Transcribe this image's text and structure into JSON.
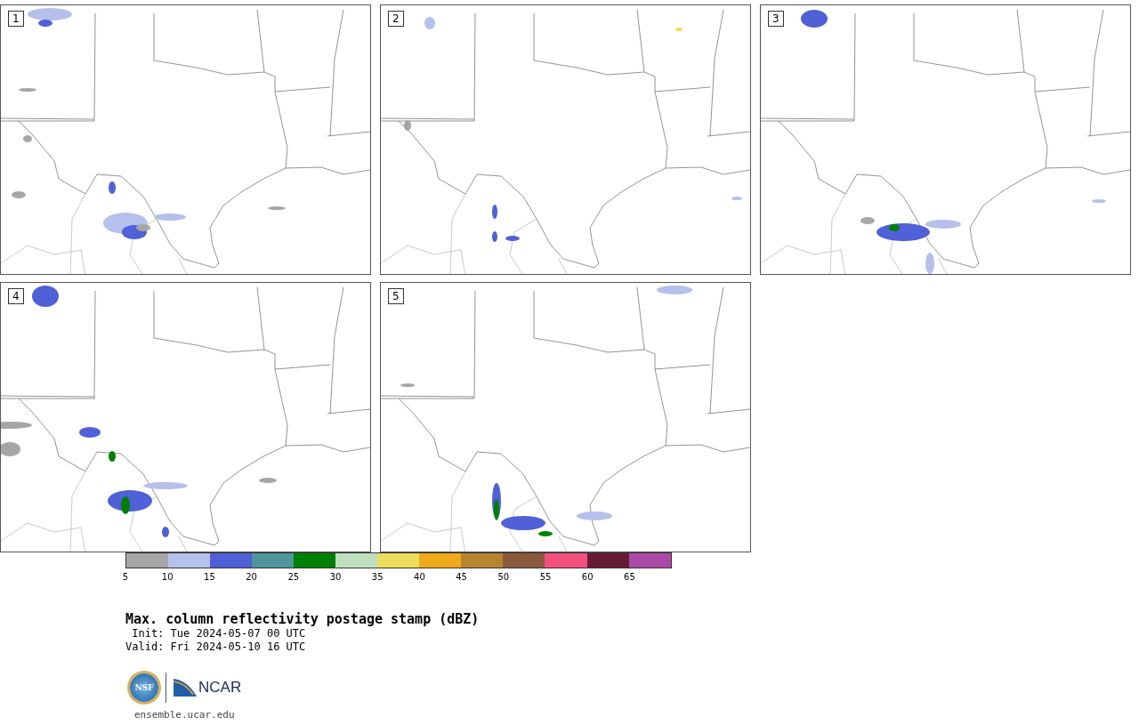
{
  "panels": [
    {
      "label": "1"
    },
    {
      "label": "2"
    },
    {
      "label": "3"
    },
    {
      "label": "4"
    },
    {
      "label": "5"
    }
  ],
  "colorbar": {
    "segments": [
      {
        "color": "#a6a6a6"
      },
      {
        "color": "#b5c0ec"
      },
      {
        "color": "#5060d6"
      },
      {
        "color": "#4e969c"
      },
      {
        "color": "#008000"
      },
      {
        "color": "#bfdfbf"
      },
      {
        "color": "#eedc5c"
      },
      {
        "color": "#efaa1a"
      },
      {
        "color": "#b9822f"
      },
      {
        "color": "#8b5a3c"
      },
      {
        "color": "#f2517f"
      },
      {
        "color": "#651a36"
      },
      {
        "color": "#ab4aa6"
      }
    ],
    "ticks": [
      "5",
      "10",
      "15",
      "20",
      "25",
      "30",
      "35",
      "40",
      "45",
      "50",
      "55",
      "60",
      "65"
    ]
  },
  "title": "Max. column reflectivity postage stamp (dBZ)",
  "init": "Init: Tue 2024-05-07 00 UTC",
  "valid": "Valid: Fri 2024-05-10 16 UTC",
  "logos": {
    "nsf": "NSF",
    "ncar": "NCAR"
  },
  "url": "ensemble.ucar.edu"
}
